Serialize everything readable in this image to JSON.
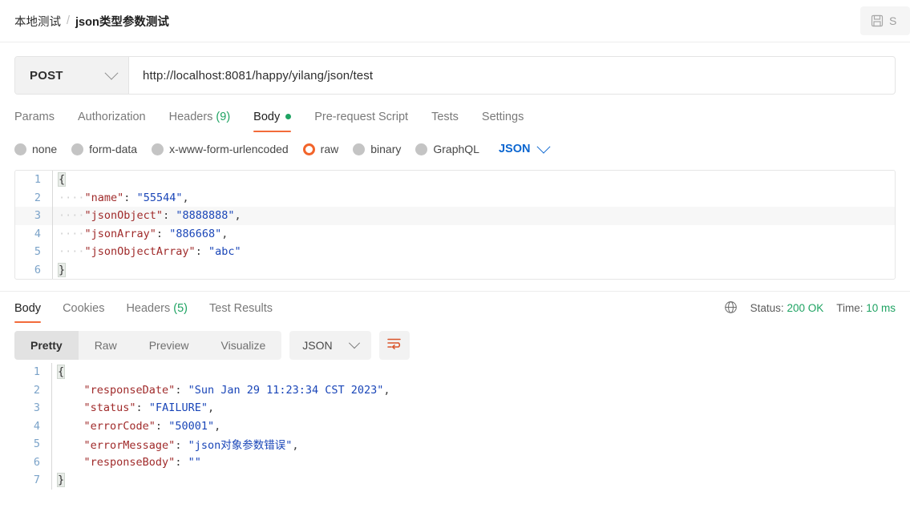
{
  "header": {
    "breadcrumb_parent": "本地测试",
    "breadcrumb_separator": "/",
    "breadcrumb_current": "json类型参数测试",
    "save_label": "S",
    "save_icon": "save-floppy-icon"
  },
  "request": {
    "method": "POST",
    "method_chevron_icon": "chevron-down-icon",
    "url": "http://localhost:8081/happy/yilang/json/test",
    "url_placeholder": "Enter request URL",
    "tabs": [
      {
        "label": "Params",
        "active": false
      },
      {
        "label": "Authorization",
        "active": false
      },
      {
        "label": "Headers",
        "count": "(9)",
        "active": false
      },
      {
        "label": "Body",
        "active": true,
        "dot": true
      },
      {
        "label": "Pre-request Script",
        "active": false
      },
      {
        "label": "Tests",
        "active": false
      },
      {
        "label": "Settings",
        "active": false
      }
    ],
    "body_types": [
      {
        "label": "none",
        "selected": false
      },
      {
        "label": "form-data",
        "selected": false
      },
      {
        "label": "x-www-form-urlencoded",
        "selected": false
      },
      {
        "label": "raw",
        "selected": true
      },
      {
        "label": "binary",
        "selected": false
      },
      {
        "label": "GraphQL",
        "selected": false
      }
    ],
    "raw_format": "JSON",
    "raw_format_chevron_icon": "chevron-down-icon",
    "body_lines": [
      {
        "n": "1",
        "text": "{"
      },
      {
        "n": "2",
        "text": "    \"name\": \"55544\","
      },
      {
        "n": "3",
        "text": "    \"jsonObject\": \"8888888\","
      },
      {
        "n": "4",
        "text": "    \"jsonArray\": \"886668\","
      },
      {
        "n": "5",
        "text": "    \"jsonObjectArray\": \"abc\""
      },
      {
        "n": "6",
        "text": "}"
      }
    ]
  },
  "response": {
    "tabs": [
      {
        "label": "Body",
        "active": true
      },
      {
        "label": "Cookies",
        "active": false
      },
      {
        "label": "Headers",
        "count": "(5)",
        "active": false
      },
      {
        "label": "Test Results",
        "active": false
      }
    ],
    "globe_icon": "globe-icon",
    "status_label": "Status:",
    "status_value": "200 OK",
    "time_label": "Time:",
    "time_value": "10 ms",
    "view_modes": [
      {
        "label": "Pretty",
        "active": true
      },
      {
        "label": "Raw",
        "active": false
      },
      {
        "label": "Preview",
        "active": false
      },
      {
        "label": "Visualize",
        "active": false
      }
    ],
    "format": "JSON",
    "format_chevron_icon": "chevron-down-icon",
    "wrap_icon": "word-wrap-icon",
    "body_lines": [
      {
        "n": "1",
        "text": "{"
      },
      {
        "n": "2",
        "text": "    \"responseDate\": \"Sun Jan 29 11:23:34 CST 2023\","
      },
      {
        "n": "3",
        "text": "    \"status\": \"FAILURE\","
      },
      {
        "n": "4",
        "text": "    \"errorCode\": \"50001\","
      },
      {
        "n": "5",
        "text": "    \"errorMessage\": \"json对象参数错误\","
      },
      {
        "n": "6",
        "text": "    \"responseBody\": \"\""
      },
      {
        "n": "7",
        "text": "}"
      }
    ]
  },
  "colors": {
    "accent_orange": "#f26b3a",
    "link_blue": "#0b66d0",
    "success_green": "#1ea362",
    "json_key": "#a02b2b",
    "json_value": "#1a46b8"
  }
}
